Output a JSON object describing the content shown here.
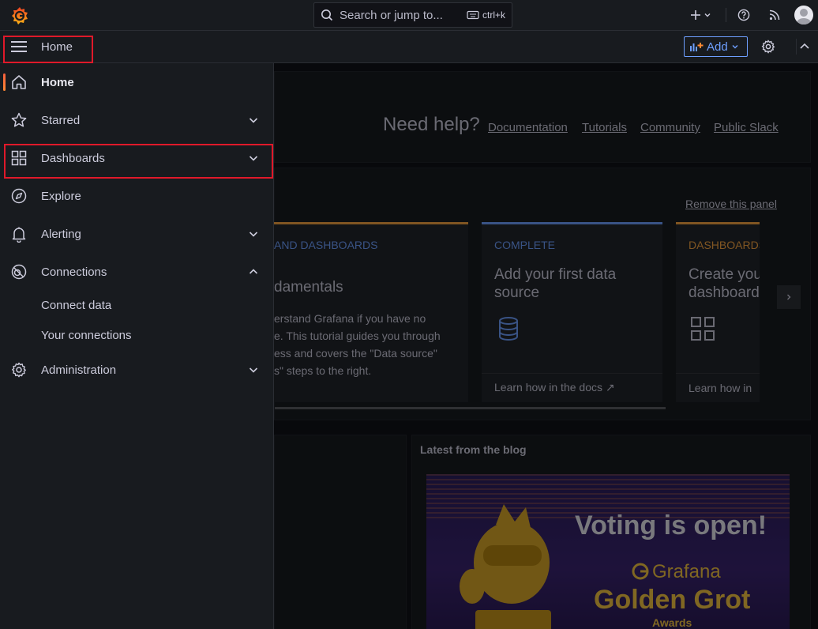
{
  "topbar": {
    "search_placeholder": "Search or jump to...",
    "search_shortcut": "ctrl+k"
  },
  "breadcrumb": {
    "home": "Home"
  },
  "toolbar": {
    "add_label": "Add"
  },
  "sidebar": {
    "items": [
      {
        "label": "Home",
        "icon": "home-icon",
        "active": true
      },
      {
        "label": "Starred",
        "icon": "star-icon"
      },
      {
        "label": "Dashboards",
        "icon": "apps-icon"
      },
      {
        "label": "Explore",
        "icon": "compass-icon"
      },
      {
        "label": "Alerting",
        "icon": "bell-icon"
      },
      {
        "label": "Connections",
        "icon": "connections-icon",
        "expanded": true
      },
      {
        "label": "Administration",
        "icon": "cog-icon"
      }
    ],
    "connections_sub": [
      "Connect data",
      "Your connections"
    ]
  },
  "main": {
    "need_help": "Need help?",
    "help_links": [
      "Documentation",
      "Tutorials",
      "Community",
      "Public Slack"
    ],
    "remove_panel": "Remove this panel",
    "cards": [
      {
        "category": "AND DASHBOARDS",
        "title": "damentals",
        "text_lines": [
          "erstand Grafana if you have no",
          "e. This tutorial guides you through",
          "ess and covers the \"Data source\"",
          "s\" steps to the right."
        ]
      },
      {
        "category": "COMPLETE",
        "title_lines": [
          "Add your first data",
          "source"
        ],
        "footer": "Learn how in the docs"
      },
      {
        "category": "DASHBOARDS",
        "title_lines": [
          "Create you",
          "dashboard"
        ],
        "footer": "Learn how in"
      }
    ],
    "blog_title": "Latest from the blog",
    "banner": {
      "headline": "Voting is open!",
      "brand": "Grafana",
      "award": "Golden Grot",
      "award_sub": "Awards"
    }
  },
  "colors": {
    "accent_blue": "#6e9fff",
    "highlight_red": "#e0192a",
    "active_orange": "#ff8833",
    "banner_yellow": "#f5c542"
  }
}
